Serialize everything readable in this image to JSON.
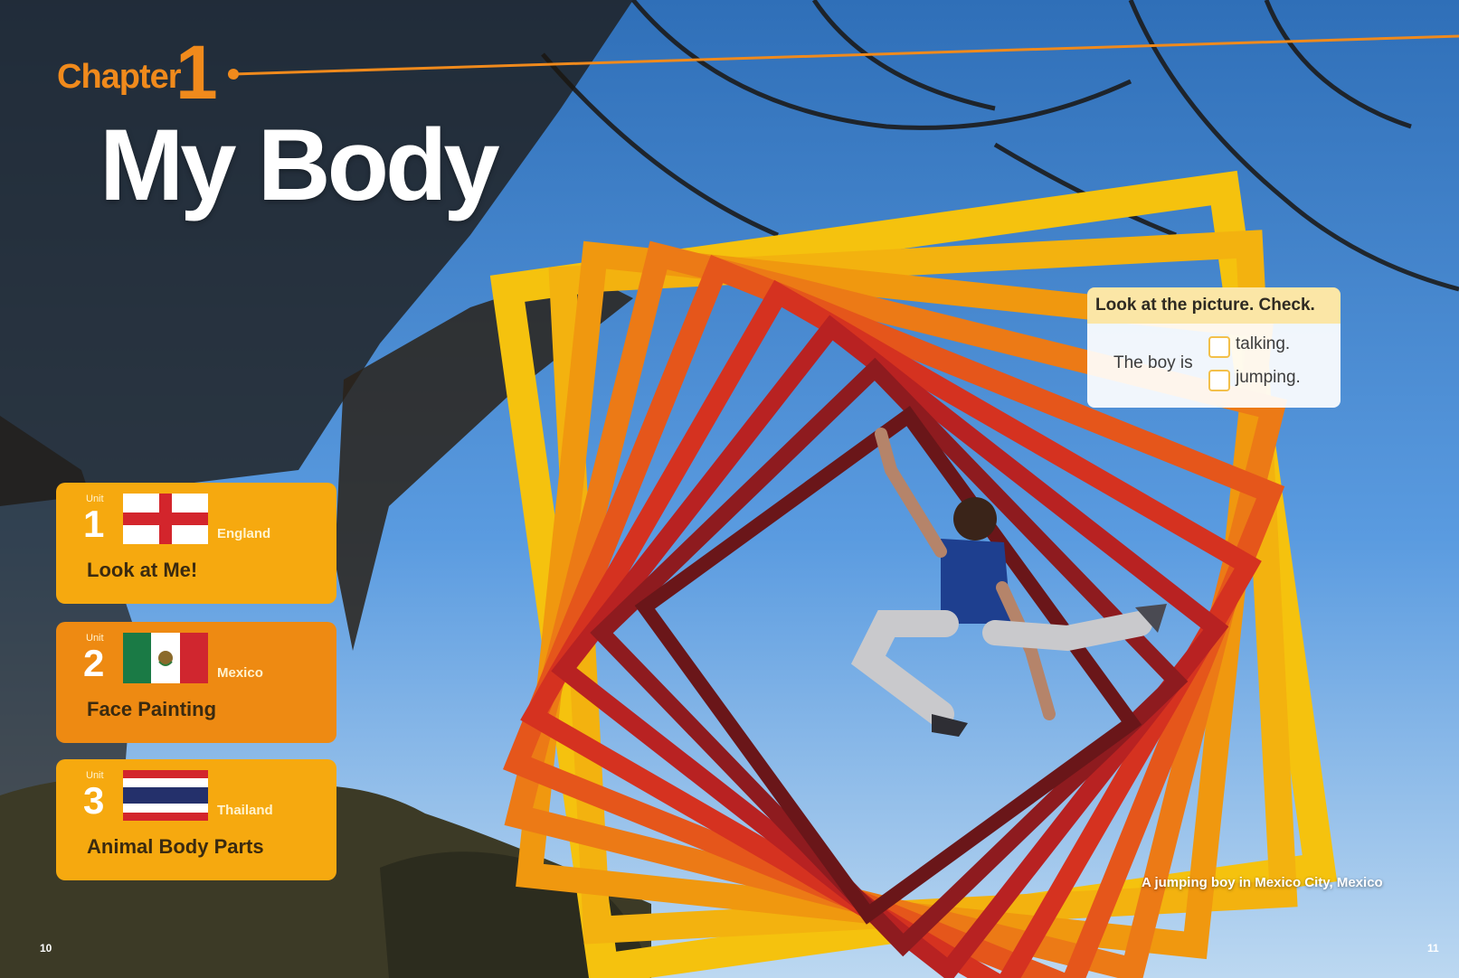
{
  "chapter": {
    "label": "Chapter",
    "number": "1",
    "title": "My Body"
  },
  "units": [
    {
      "word": "Unit",
      "number": "1",
      "country": "England",
      "title": "Look at Me!",
      "flag_icon": "england-flag-icon"
    },
    {
      "word": "Unit",
      "number": "2",
      "country": "Mexico",
      "title": "Face Painting",
      "flag_icon": "mexico-flag-icon"
    },
    {
      "word": "Unit",
      "number": "3",
      "country": "Thailand",
      "title": "Animal Body Parts",
      "flag_icon": "thailand-flag-icon"
    }
  ],
  "activity": {
    "header": "Look at the picture. Check.",
    "stem": "The boy is",
    "options": [
      "talking.",
      "jumping."
    ]
  },
  "caption": "A jumping boy in Mexico City, Mexico",
  "page_numbers": {
    "left": "10",
    "right": "11"
  },
  "colors": {
    "accent_orange": "#f08a1c",
    "card_yellow": "#f6a90f",
    "card_orange": "#ee8a12",
    "sky": "#4c8fd6"
  }
}
